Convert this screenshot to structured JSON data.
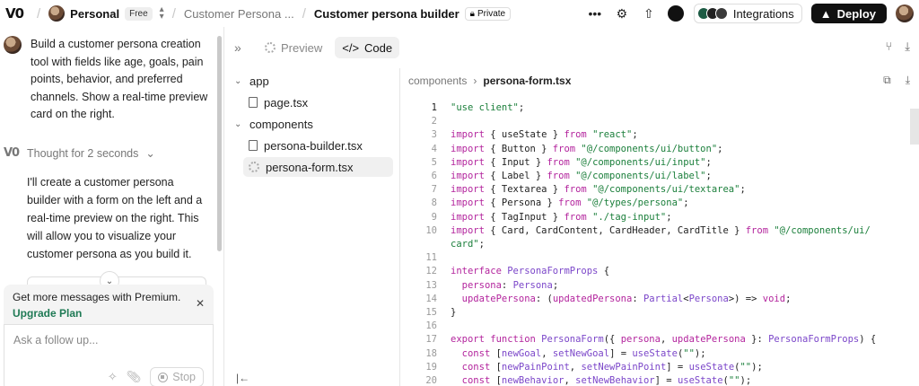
{
  "topbar": {
    "logo": "V0",
    "workspace": "Personal",
    "plan_badge": "Free",
    "project": "Customer Persona ...",
    "chat_title": "Customer persona builder",
    "private_badge": "Private",
    "integrations_label": "Integrations",
    "deploy_label": "Deploy"
  },
  "chat": {
    "user_message": "Build a customer persona creation tool with fields like age, goals, pain points, behavior, and preferred channels. Show a real-time preview card on the right.",
    "thought_label": "Thought for 2 seconds",
    "assistant_message": "I'll create a customer persona builder with a form on the left and a real-time preview on the right. This will allow you to visualize your customer persona as you build it.",
    "upgrade_text": "Get more messages with Premium.",
    "upgrade_link": "Upgrade Plan",
    "composer_placeholder": "Ask a follow up...",
    "stop_label": "Stop"
  },
  "tabs": {
    "preview_label": "Preview",
    "code_label": "Code"
  },
  "file_tree": {
    "folder_app": "app",
    "file_page": "page.tsx",
    "folder_components": "components",
    "file_builder": "persona-builder.tsx",
    "file_form": "persona-form.tsx"
  },
  "editor": {
    "crumb_folder": "components",
    "crumb_file": "persona-form.tsx",
    "line_numbers": [
      "1",
      "2",
      "3",
      "4",
      "5",
      "6",
      "7",
      "8",
      "9",
      "10",
      "",
      "11",
      "12",
      "13",
      "14",
      "15",
      "16",
      "17",
      "18",
      "19",
      "20"
    ]
  },
  "colors": {
    "keyword": "#b3249d",
    "string": "#1b7f3b",
    "type": "#7b46c9",
    "upgrade_link": "#1f7a55"
  }
}
